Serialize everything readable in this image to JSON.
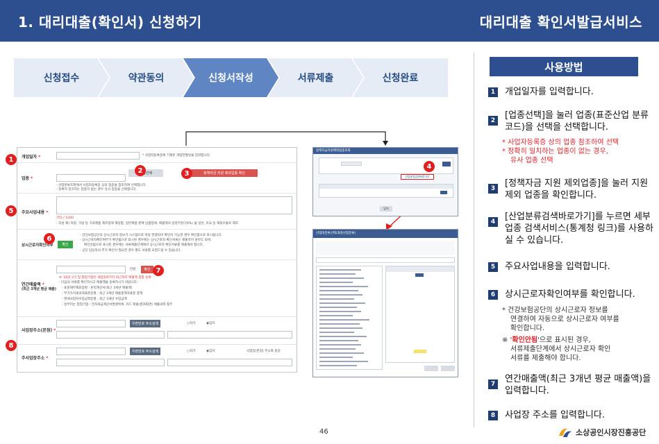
{
  "header": {
    "title_left": "1. 대리대출(확인서) 신청하기",
    "title_right": "대리대출 확인서발급서비스"
  },
  "steps": [
    {
      "label": "신청접수",
      "active": false
    },
    {
      "label": "약관동의",
      "active": false
    },
    {
      "label": "신청서작성",
      "active": true
    },
    {
      "label": "서류제출",
      "active": false
    },
    {
      "label": "신청완료",
      "active": false
    }
  ],
  "form": {
    "open_date_label": "개업일자",
    "open_date_hint": "* 사업자등록증에 기재된 개업연월일을 입력합니다.",
    "industry_label": "업종",
    "industry_select_button": "업종선택",
    "industry_check_button": "정책자금 지원 제외업종 확인",
    "industry_hint_1": "- 산업분류조회에서 사업자등록증 상의 업종을 참조하여 선택합니다.",
    "industry_hint_2": "- 정확히 일치하는 업종이 없는 경우 유사 업종을 선택합니다.",
    "business_label": "주요사업내용",
    "char_count": "755 / 1000",
    "business_hint": "- 작성 예) 자갈, 가방 등 가죽제품 제조업에 해당함, 일반제품 판매 납품업에, 매출액의 일정부분(70%) 을 일반, 미국 등 해외수출로 제조",
    "workers_label": "상시근로자확인여부",
    "workers_button": "확인",
    "workers_hint_1": "- 건강보험공단의 상시근로자 정보가 시스템으로 자동 연결되어 확인이 가능한 경우 확인함으로 표시됩니다.",
    "workers_hint_2": "- 상시근로자확인여부가 확인됨으로 표시된 경우에는 상시근로자 확인서류는 제출하지 않아도 되며,",
    "workers_hint_3": "확인안됨으로 표시된 경우에는 서류제출단계에서 상시근로자 확인서류를 제출해야 합니다.",
    "workers_hint_4": "- 공단 담당자의 추가 확인이 필요한 경우 별도 서류를 요청드릴 수 있습니다.",
    "sales_label": "연간매출액",
    "sales_label_2": "(최근 3개년 평균 매출)",
    "sales_unit": "만원",
    "sales_button": "확인",
    "sales_hint_red": "※ '20년 2기 및 창업기업은 개업일로부터 최근까지 매출액 총합 등록",
    "sales_hint_1": "- 다음의 서류를 확인하시고 매출액을 등록하시기 바랍니다.",
    "sales_hint_2": "- 표준재무제표증명 : 손익계산서(최근 3개년 매출액)",
    "sales_hint_3": "- 부가가치세과세표준증명 : 최근 3개년 매출총액과표준 총액",
    "sales_hint_4": "- 면세사업자수입금액증명 : 최근 3개년 수입금액",
    "sales_hint_5": "- 일부터는 창업기업 : 전자세금계산서발행목록, 카드 매출(캡쳐화면) 매출내역 첨부",
    "address_label": "사업장주소(본점)",
    "address_button": "우편번호 주소검색",
    "own_label": "○자가",
    "rent_label": "◉임차",
    "address2_label": "주사업장주소",
    "address2_button": "우편번호 주소검색",
    "same_label": "사업장(본점) 주소와 동일"
  },
  "window1": {
    "title": "정책자금지원제외업종조회",
    "link_button": "산업분류검색바로가기",
    "close_button": "닫기"
  },
  "window2": {
    "title": "산업대분류선택(표준산업분류)"
  },
  "panel": {
    "title": "사용방법",
    "items": [
      {
        "num": "1",
        "text": "개업일자를 입력합니다."
      },
      {
        "num": "2",
        "text": "[업종선택]을 눌러 업종(표준산업 분류코드)을 선택을 선택합니다."
      },
      {
        "num": "3",
        "text": "[정책자금 지원 제외업종]을 눌러 지원제외 업종을 확인합니다."
      },
      {
        "num": "4",
        "text": "[산업분류검색바로가기]를 누르면 세부업종 검색서비스(통계청 링크)를 사용하실 수 있습니다."
      },
      {
        "num": "5",
        "text": "주요사업내용을 입력합니다."
      },
      {
        "num": "6",
        "text": "상시근로자확인여부를 확인합니다."
      },
      {
        "num": "7",
        "text": "연간매출액(최근 3개년 평균 매출액)을 입력합니다."
      },
      {
        "num": "8",
        "text": "사업장 주소를 입력합니다."
      }
    ],
    "note2_1": "* 사업자등록증 상의 업종 참조하여 선택",
    "note2_2": "* 정확히 일치하는 업종이 없는 경우,",
    "note2_3": "유사 업종 선택",
    "note6_1": "* 건강보험공단의 상시근로자 정보를",
    "note6_2": "연결하여 자동으로 상시근로자 여부를",
    "note6_3": "확인합니다.",
    "note6_4_prefix": "※ '",
    "note6_4_red": "확인안됨",
    "note6_4_suffix": "'으로 표시된 경우,",
    "note6_5": "서류제출단계에서 상시근로자 확인",
    "note6_6": "서류를 제출해야 합니다."
  },
  "footer": {
    "page_number": "46",
    "org_name": "소상공인시장진흥공단"
  },
  "colors": {
    "brand_blue": "#2d4f8f",
    "badge_red": "#e02020",
    "step_inactive": "#e6ecf5",
    "step_active": "#5f86c2",
    "note_red": "#e0242c"
  }
}
